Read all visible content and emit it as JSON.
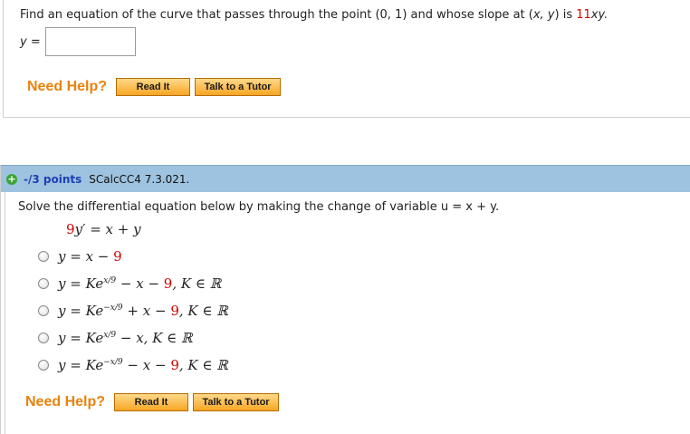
{
  "question1": {
    "prompt_prefix": "Find an equation of the curve that passes through the point (0, 1) and whose slope at (",
    "prompt_vars": "x, y",
    "prompt_mid": ") is ",
    "prompt_coef": "11",
    "prompt_end": "xy.",
    "answer_label": "y =",
    "answer_value": ""
  },
  "help": {
    "label": "Need Help?",
    "read_it": "Read It",
    "talk_tutor": "Talk to a Tutor"
  },
  "question2": {
    "points": "-/3 points",
    "id": "SCalcCC4 7.3.021.",
    "prompt": "Solve the differential equation below by making the change of variable u = x + y.",
    "equation_coef": "9",
    "equation_rest": "y′ = x + y",
    "options": [
      {
        "lhs": "y = x − ",
        "n": "9",
        "tail": ""
      },
      {
        "lhs": "y = Ke",
        "exp": "x/9",
        "mid": " − x − ",
        "n": "9",
        "tail": ", K ∈ ℝ"
      },
      {
        "lhs": "y = Ke",
        "exp": "−x/9",
        "mid": " + x − ",
        "n": "9",
        "tail": ", K ∈ ℝ"
      },
      {
        "lhs": "y = Ke",
        "exp": "x/9",
        "mid": " − x, K ∈ ℝ",
        "n": "",
        "tail": ""
      },
      {
        "lhs": "y = Ke",
        "exp": "−x/9",
        "mid": " − x − ",
        "n": "9",
        "tail": ", K ∈ ℝ"
      }
    ]
  }
}
